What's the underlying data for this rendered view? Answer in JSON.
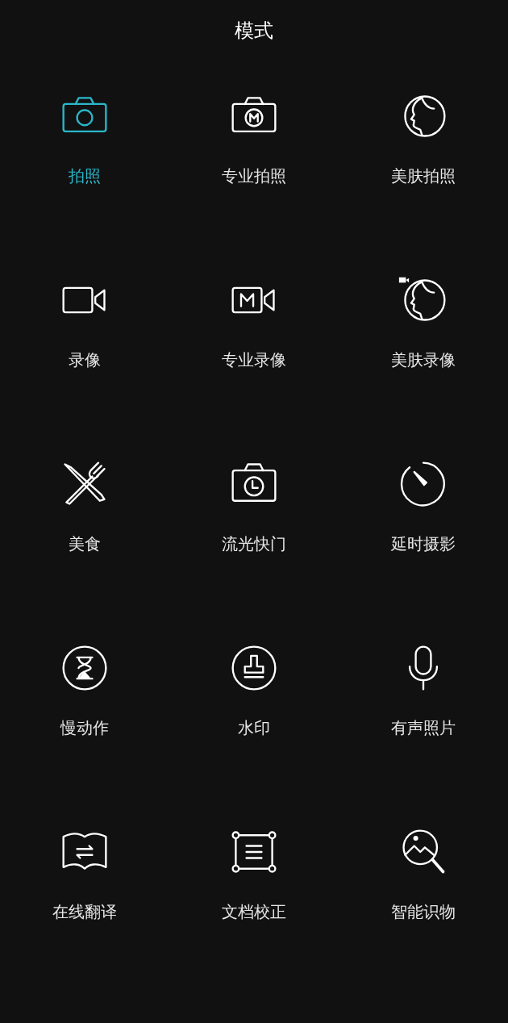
{
  "title": "模式",
  "modes": [
    {
      "label": "拍照",
      "kind": "photo",
      "selected": true
    },
    {
      "label": "专业拍照",
      "kind": "pro-photo",
      "selected": false
    },
    {
      "label": "美肤拍照",
      "kind": "beauty-photo",
      "selected": false
    },
    {
      "label": "录像",
      "kind": "video",
      "selected": false
    },
    {
      "label": "专业录像",
      "kind": "pro-video",
      "selected": false
    },
    {
      "label": "美肤录像",
      "kind": "beauty-video",
      "selected": false
    },
    {
      "label": "美食",
      "kind": "food",
      "selected": false
    },
    {
      "label": "流光快门",
      "kind": "light-painting",
      "selected": false
    },
    {
      "label": "延时摄影",
      "kind": "timelapse",
      "selected": false
    },
    {
      "label": "慢动作",
      "kind": "slow-motion",
      "selected": false
    },
    {
      "label": "水印",
      "kind": "watermark",
      "selected": false
    },
    {
      "label": "有声照片",
      "kind": "audio-photo",
      "selected": false
    },
    {
      "label": "在线翻译",
      "kind": "translate",
      "selected": false
    },
    {
      "label": "文档校正",
      "kind": "document",
      "selected": false
    },
    {
      "label": "智能识物",
      "kind": "recognize",
      "selected": false
    }
  ]
}
